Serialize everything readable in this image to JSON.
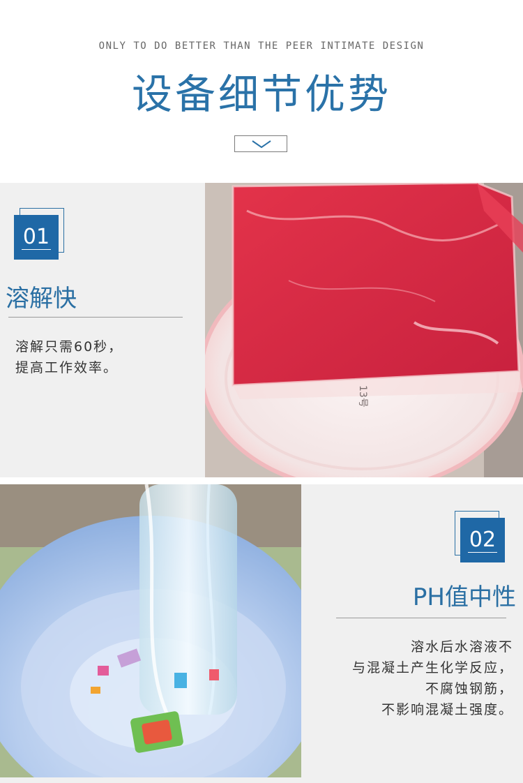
{
  "header": {
    "tagline": "ONLY TO DO BETTER THAN THE PEER INTIMATE DESIGN",
    "title": "设备细节优势"
  },
  "features": [
    {
      "number": "01",
      "title": "溶解快",
      "desc_lines": [
        "溶解只需60秒，",
        "提高工作效率。"
      ]
    },
    {
      "number": "02",
      "title": "PH值中性",
      "desc_lines": [
        "溶水后水溶液不",
        "与混凝土产生化学反应，",
        "不腐蚀钢筋，",
        "不影响混凝土强度。"
      ]
    }
  ],
  "photo1": {
    "label": "13号"
  },
  "photo2": {},
  "colors": {
    "accent": "#1f68a6",
    "section_bg": "#f0f0f0"
  }
}
